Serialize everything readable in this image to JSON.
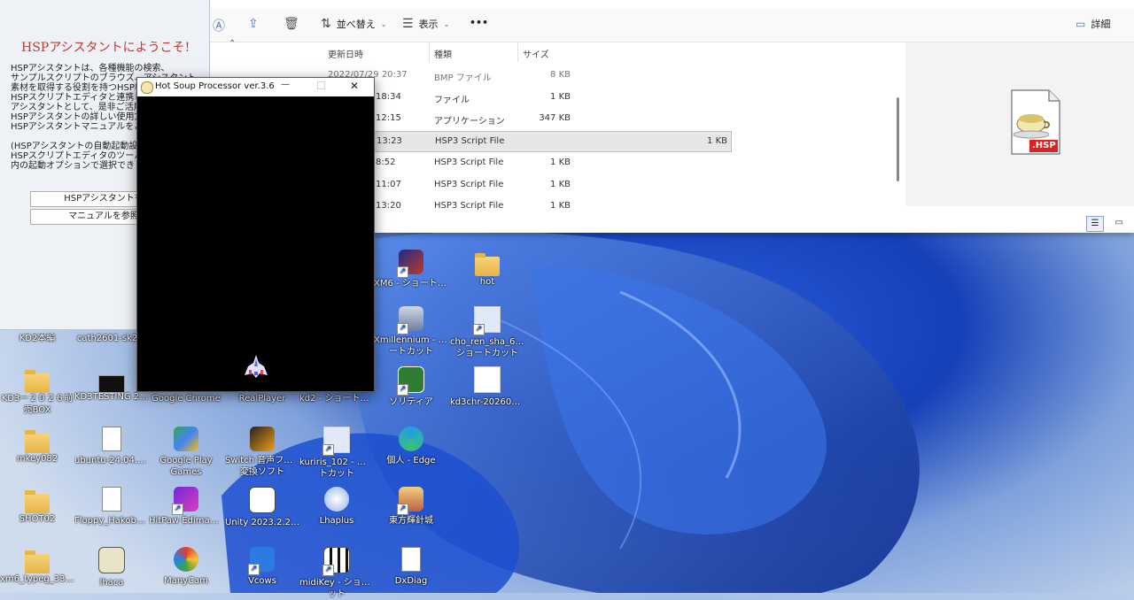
{
  "explorer": {
    "toolbar": {
      "sort_label": "並べ替え",
      "view_label": "表示",
      "more_label": "•••",
      "details_label": "詳細"
    },
    "columns": [
      "更新日時",
      "種類",
      "サイズ"
    ],
    "rows": [
      {
        "date": "2022/07/29 20:37",
        "type": "BMP ファイル",
        "size": "8 KB",
        "selected": false
      },
      {
        "date": "18:34",
        "type": "ファイル",
        "size": "1 KB",
        "selected": false
      },
      {
        "date": "12:15",
        "type": "アプリケーション",
        "size": "347 KB",
        "selected": false
      },
      {
        "date": "13:23",
        "type": "HSP3 Script File",
        "size": "1 KB",
        "selected": true
      },
      {
        "date": "8:52",
        "type": "HSP3 Script File",
        "size": "1 KB",
        "selected": false
      },
      {
        "date": "11:07",
        "type": "HSP3 Script File",
        "size": "1 KB",
        "selected": false
      },
      {
        "date": "13:20",
        "type": "HSP3 Script File",
        "size": "1 KB",
        "selected": false
      }
    ],
    "preview_file_ext": ".HSP"
  },
  "assistant": {
    "title": "HSPアシスタントにようこそ!",
    "body": "HSPアシスタントは、各種機能の検索、\nサンプルスクリプトのブラウズ、アシスタント\n素材を取得する役割を持つHSP標準ツール\nHSPスクリプトエディタと連携し、\nアシスタントとして、是非ご活用\nHSPアシスタントの詳しい使用方\nHSPアシスタントマニュアルをご\n\n(HSPアシスタントの自動起動設\nHSPスクリプトエディタのツール\n内の起動オプションで選択でき",
    "start_button": "HSPアシスタントを開始",
    "manual_button": "マニュアルを参照する"
  },
  "hsp_window": {
    "title": "Hot Soup Processor ver.3.6",
    "minimize": "—",
    "maximize": "☐",
    "close": "✕"
  },
  "desktop_icons": [
    {
      "label": "KD2本編",
      "kind": "folder"
    },
    {
      "label": "cath2601-sk2rk",
      "kind": "file"
    },
    {
      "label": "KD3ー２０２６前",
      "label2": "売BOX",
      "kind": "folder"
    },
    {
      "label": "KD3TESTING 20...",
      "kind": "term"
    },
    {
      "label": "Google Chrome",
      "kind": "app"
    },
    {
      "label": "RealPlayer",
      "kind": "app"
    },
    {
      "label": "kd2 - ショートカット",
      "kind": "app"
    },
    {
      "label": "mkey082",
      "kind": "folder"
    },
    {
      "label": "ubuntu-24.04.3-...",
      "kind": "file"
    },
    {
      "label": "Google Play",
      "label2": "Games",
      "kind": "app"
    },
    {
      "label": "Switch 音声ファイル",
      "label2": "変換ソフト",
      "kind": "app"
    },
    {
      "label": "kuriris_102 - ショー",
      "label2": "トカット",
      "kind": "app"
    },
    {
      "label": "個人 - Edge",
      "kind": "app"
    },
    {
      "label": "SHOT02",
      "kind": "folder"
    },
    {
      "label": "Floppy_Hakobu...",
      "kind": "file"
    },
    {
      "label": "HitPaw Edimakor",
      "kind": "app"
    },
    {
      "label": "Unity 2023.2.20f1",
      "kind": "app"
    },
    {
      "label": "Lhaplus",
      "kind": "app"
    },
    {
      "label": "東方輝針城",
      "kind": "app"
    },
    {
      "label": "xm6_typeg_338...",
      "kind": "folder"
    },
    {
      "label": "lhaca",
      "kind": "app"
    },
    {
      "label": "ManyCam",
      "kind": "app"
    },
    {
      "label": "Vcows",
      "kind": "app"
    },
    {
      "label": "midiKey - ショートカ",
      "label2": "ット",
      "kind": "app"
    },
    {
      "label": "DxDiag",
      "kind": "file"
    },
    {
      "label": "XM6 - ショートカット",
      "kind": "app"
    },
    {
      "label": "hot",
      "kind": "folder"
    },
    {
      "label": "Xmillennium - ショ",
      "label2": "ートカット",
      "kind": "app"
    },
    {
      "label": "cho_ren_sha_68k -",
      "label2": "ショートカット",
      "kind": "app"
    },
    {
      "label": "ソリティア",
      "kind": "app"
    },
    {
      "label": "kd3chr-20260621",
      "kind": "file"
    }
  ],
  "colors": {
    "accent": "#1a5fd1",
    "assistant_title": "#c0392b",
    "selection": "#e6e6e6"
  }
}
